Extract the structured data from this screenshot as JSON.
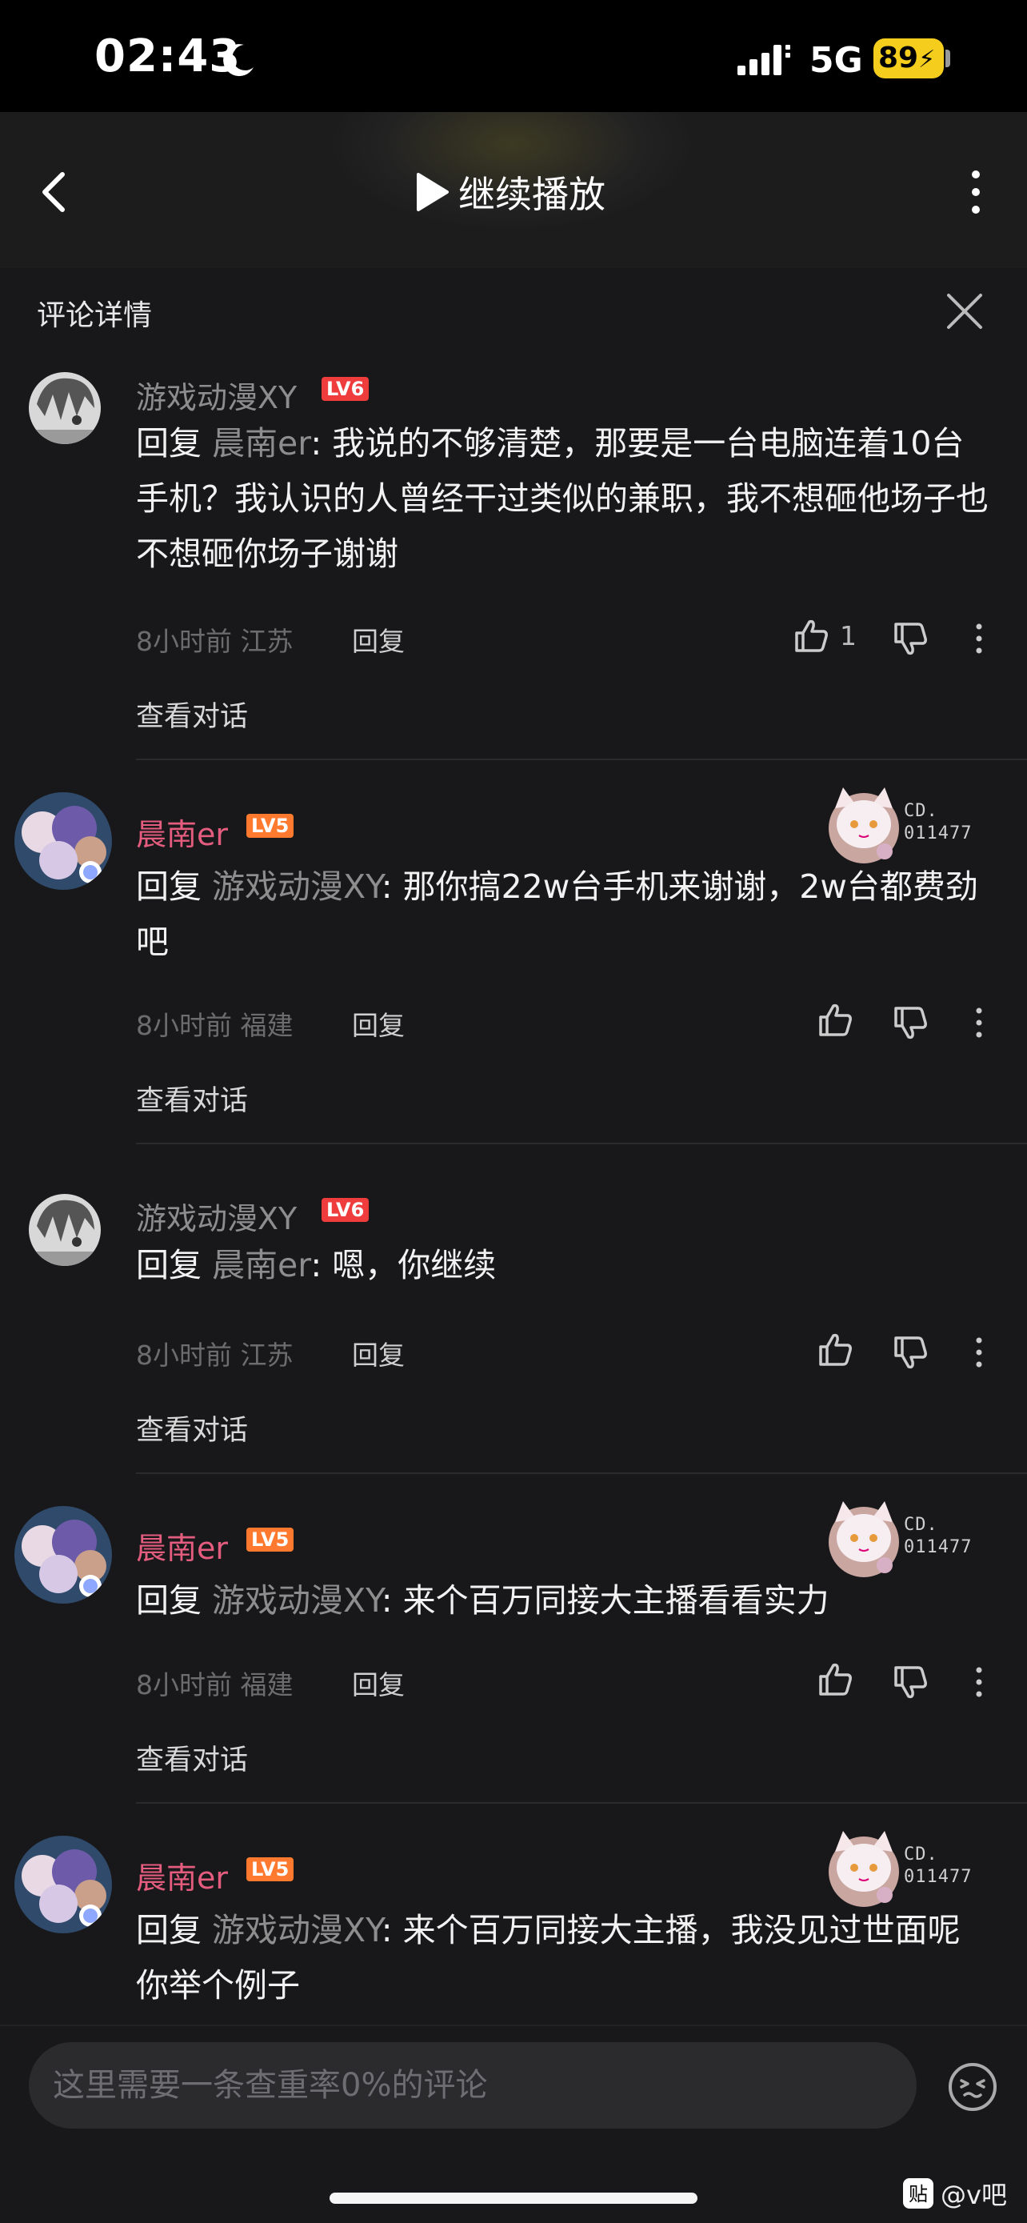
{
  "status_bar": {
    "time": "02:43",
    "network": "5G",
    "battery": "89"
  },
  "header": {
    "resume_label": "继续播放"
  },
  "panel": {
    "title": "评论详情"
  },
  "comments": [
    {
      "username": "游戏动漫XY",
      "level": "LV6",
      "reply_prefix": "回复 ",
      "reply_target": "晨南er",
      "text": ": 我说的不够清楚，那要是一台电脑连着10台手机？我认识的人曾经干过类似的兼职，我不想砸他场子也不想砸你场子谢谢",
      "time": "8小时前",
      "location": "江苏",
      "reply_label": "回复",
      "likes": "1",
      "view_thread": "查看对话"
    },
    {
      "username": "晨南er",
      "level": "LV5",
      "badge_code": "CD.\n011477",
      "reply_prefix": "回复 ",
      "reply_target": "游戏动漫XY",
      "text": ": 那你搞22w台手机来谢谢，2w台都费劲吧",
      "time": "8小时前",
      "location": "福建",
      "reply_label": "回复",
      "view_thread": "查看对话"
    },
    {
      "username": "游戏动漫XY",
      "level": "LV6",
      "reply_prefix": "回复 ",
      "reply_target": "晨南er",
      "text": ": 嗯，你继续",
      "time": "8小时前",
      "location": "江苏",
      "reply_label": "回复",
      "view_thread": "查看对话"
    },
    {
      "username": "晨南er",
      "level": "LV5",
      "badge_code": "CD.\n011477",
      "reply_prefix": "回复 ",
      "reply_target": "游戏动漫XY",
      "text": ": 来个百万同接大主播看看实力",
      "time": "8小时前",
      "location": "福建",
      "reply_label": "回复",
      "view_thread": "查看对话"
    },
    {
      "username": "晨南er",
      "level": "LV5",
      "badge_code": "CD.\n011477",
      "reply_prefix": "回复 ",
      "reply_target": "游戏动漫XY",
      "text": ": 来个百万同接大主播，我没见过世面呢你举个例子"
    }
  ],
  "input": {
    "placeholder": "这里需要一条查重率0%的评论"
  },
  "watermark": {
    "text": "@v吧"
  },
  "colors": {
    "background": "#18181b",
    "username_pink": "#e45c7e",
    "lv6": "#ef3c3c",
    "lv5": "#ff7a2e",
    "battery": "#f5cd1d"
  }
}
